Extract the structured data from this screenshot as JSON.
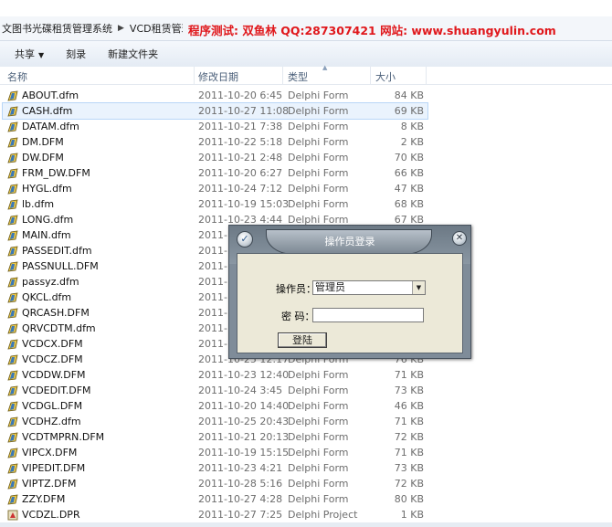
{
  "address_bar": {
    "crumbs": [
      "文图书光碟租赁管理系统",
      "VCD租赁管理"
    ],
    "watermark": "程序测试: 双鱼林 QQ:287307421  网站: www.shuangyulin.com"
  },
  "toolbar": {
    "share_label": "共享",
    "burn_label": "刻录",
    "new_folder_label": "新建文件夹"
  },
  "columns": {
    "name": "名称",
    "date": "修改日期",
    "type": "类型",
    "size": "大小"
  },
  "files": [
    {
      "name": "ABOUT.dfm",
      "date": "2011-10-20 6:45",
      "type": "Delphi Form",
      "size": "84 KB",
      "icon": "delphi-form-icon"
    },
    {
      "name": "CASH.dfm",
      "date": "2011-10-27 11:08",
      "type": "Delphi Form",
      "size": "69 KB",
      "icon": "delphi-form-icon",
      "selected": true
    },
    {
      "name": "DATAM.dfm",
      "date": "2011-10-21 7:38",
      "type": "Delphi Form",
      "size": "8 KB",
      "icon": "delphi-form-icon"
    },
    {
      "name": "DM.DFM",
      "date": "2011-10-22 5:18",
      "type": "Delphi Form",
      "size": "2 KB",
      "icon": "delphi-form-icon"
    },
    {
      "name": "DW.DFM",
      "date": "2011-10-21 2:48",
      "type": "Delphi Form",
      "size": "70 KB",
      "icon": "delphi-form-icon"
    },
    {
      "name": "FRM_DW.DFM",
      "date": "2011-10-20 6:27",
      "type": "Delphi Form",
      "size": "66 KB",
      "icon": "delphi-form-icon"
    },
    {
      "name": "HYGL.dfm",
      "date": "2011-10-24 7:12",
      "type": "Delphi Form",
      "size": "47 KB",
      "icon": "delphi-form-icon"
    },
    {
      "name": "lb.dfm",
      "date": "2011-10-19 15:03",
      "type": "Delphi Form",
      "size": "68 KB",
      "icon": "delphi-form-icon"
    },
    {
      "name": "LONG.dfm",
      "date": "2011-10-23 4:44",
      "type": "Delphi Form",
      "size": "67 KB",
      "icon": "delphi-form-icon"
    },
    {
      "name": "MAIN.dfm",
      "date": "2011-1",
      "type": "",
      "size": "",
      "icon": "delphi-form-icon"
    },
    {
      "name": "PASSEDIT.dfm",
      "date": "2011-1",
      "type": "",
      "size": "",
      "icon": "delphi-form-icon"
    },
    {
      "name": "PASSNULL.DFM",
      "date": "2011-1",
      "type": "",
      "size": "",
      "icon": "delphi-form-icon"
    },
    {
      "name": "passyz.dfm",
      "date": "2011-1",
      "type": "",
      "size": "",
      "icon": "delphi-form-icon"
    },
    {
      "name": "QKCL.dfm",
      "date": "2011-1",
      "type": "",
      "size": "",
      "icon": "delphi-form-icon"
    },
    {
      "name": "QRCASH.DFM",
      "date": "2011-1",
      "type": "",
      "size": "",
      "icon": "delphi-form-icon"
    },
    {
      "name": "QRVCDTM.dfm",
      "date": "2011-1",
      "type": "",
      "size": "",
      "icon": "delphi-form-icon"
    },
    {
      "name": "VCDCX.DFM",
      "date": "2011-1",
      "type": "",
      "size": "",
      "icon": "delphi-form-icon"
    },
    {
      "name": "VCDCZ.DFM",
      "date": "2011-10-25 12:17",
      "type": "Delphi Form",
      "size": "76 KB",
      "icon": "delphi-form-icon"
    },
    {
      "name": "VCDDW.DFM",
      "date": "2011-10-23 12:40",
      "type": "Delphi Form",
      "size": "71 KB",
      "icon": "delphi-form-icon"
    },
    {
      "name": "VCDEDIT.DFM",
      "date": "2011-10-24 3:45",
      "type": "Delphi Form",
      "size": "73 KB",
      "icon": "delphi-form-icon"
    },
    {
      "name": "VCDGL.DFM",
      "date": "2011-10-20 14:40",
      "type": "Delphi Form",
      "size": "46 KB",
      "icon": "delphi-form-icon"
    },
    {
      "name": "VCDHZ.dfm",
      "date": "2011-10-25 20:43",
      "type": "Delphi Form",
      "size": "71 KB",
      "icon": "delphi-form-icon"
    },
    {
      "name": "VCDTMPRN.DFM",
      "date": "2011-10-21 20:13",
      "type": "Delphi Form",
      "size": "72 KB",
      "icon": "delphi-form-icon"
    },
    {
      "name": "VIPCX.DFM",
      "date": "2011-10-19 15:15",
      "type": "Delphi Form",
      "size": "71 KB",
      "icon": "delphi-form-icon"
    },
    {
      "name": "VIPEDIT.DFM",
      "date": "2011-10-23 4:21",
      "type": "Delphi Form",
      "size": "73 KB",
      "icon": "delphi-form-icon"
    },
    {
      "name": "VIPTZ.DFM",
      "date": "2011-10-28 5:16",
      "type": "Delphi Form",
      "size": "72 KB",
      "icon": "delphi-form-icon"
    },
    {
      "name": "ZZY.DFM",
      "date": "2011-10-27 4:28",
      "type": "Delphi Form",
      "size": "80 KB",
      "icon": "delphi-form-icon"
    },
    {
      "name": "VCDZL.DPR",
      "date": "2011-10-27 7:25",
      "type": "Delphi Project",
      "size": "1 KB",
      "icon": "delphi-project-icon"
    }
  ],
  "login_dialog": {
    "title": "操作员登录",
    "operator_label": "操作员：",
    "operator_value": "管理员",
    "password_label": "密  码：",
    "password_value": "",
    "login_button": "登陆"
  }
}
